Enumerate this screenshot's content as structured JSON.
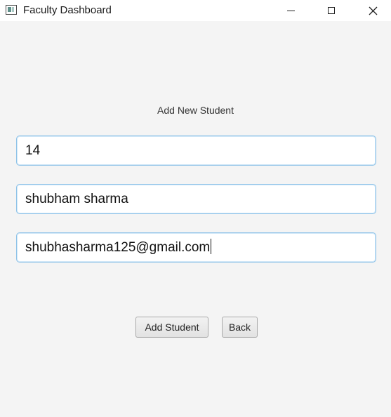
{
  "window": {
    "title": "Faculty Dashboard",
    "icon": "app-window-icon"
  },
  "form": {
    "heading": "Add New Student",
    "fields": [
      {
        "name": "student-id",
        "value": "14"
      },
      {
        "name": "student-name",
        "value": "shubham sharma"
      },
      {
        "name": "student-email",
        "value": "shubhasharma125@gmail.com"
      }
    ],
    "buttons": {
      "add_label": "Add Student",
      "back_label": "Back"
    }
  },
  "colors": {
    "background": "#f4f4f4",
    "field_border": "#8fc3e8",
    "button_border": "#a9a9a9"
  }
}
